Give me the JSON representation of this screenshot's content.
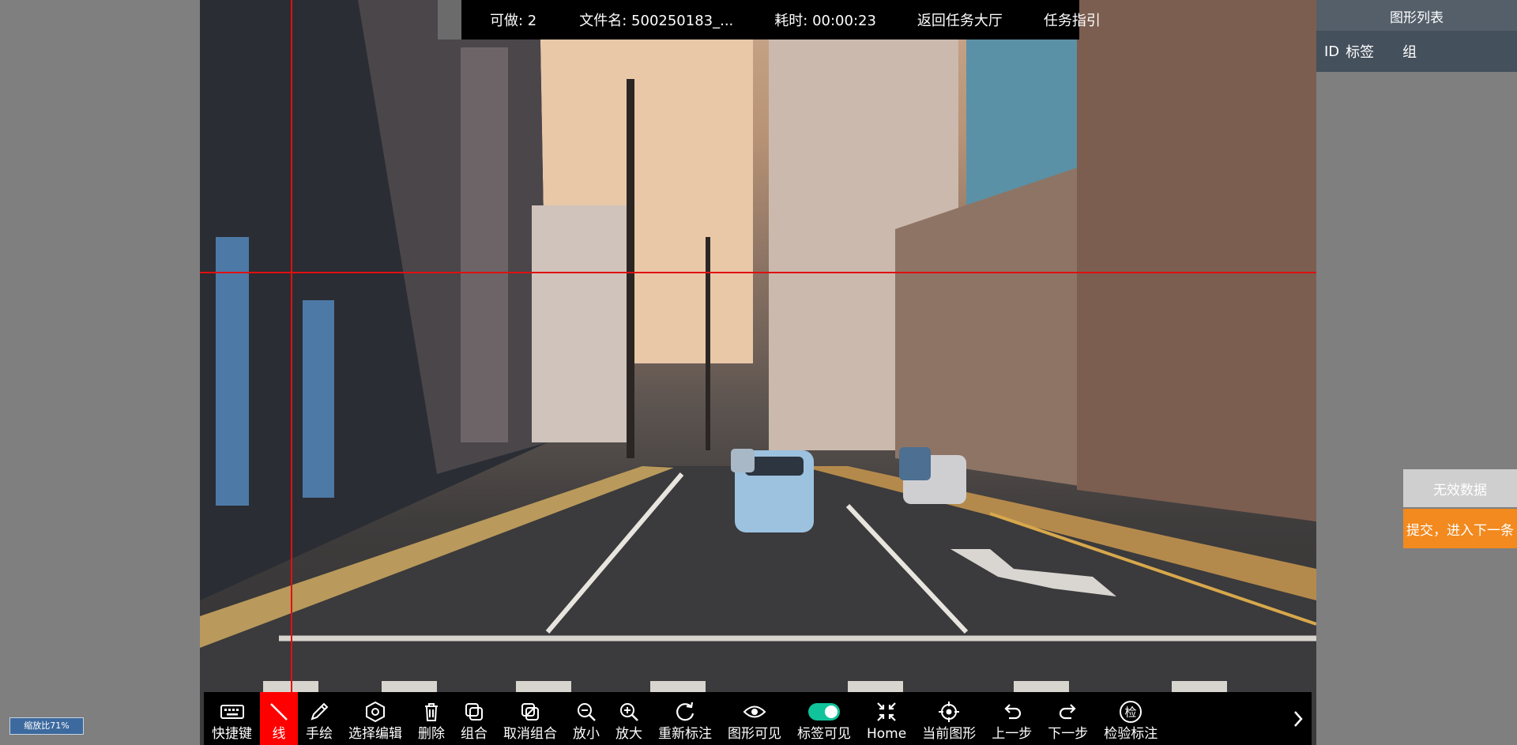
{
  "topbar": {
    "remaining": "可做: 2",
    "filename": "文件名: 500250183_...",
    "elapsed": "耗时: 00:00:23",
    "back": "返回任务大厅",
    "guide": "任务指引"
  },
  "shape_panel": {
    "title": "图形列表",
    "columns": [
      "ID",
      "标签",
      "组"
    ]
  },
  "actions": {
    "invalid": "无效数据",
    "submit": "提交，进入下一条"
  },
  "toolbar": {
    "items": [
      {
        "label": "快捷键",
        "icon": "keyboard-icon"
      },
      {
        "label": "线",
        "icon": "line-icon",
        "active": true
      },
      {
        "label": "手绘",
        "icon": "pencil-icon"
      },
      {
        "label": "选择编辑",
        "icon": "hexagon-select-icon"
      },
      {
        "label": "删除",
        "icon": "trash-icon"
      },
      {
        "label": "组合",
        "icon": "group-icon"
      },
      {
        "label": "取消组合",
        "icon": "ungroup-icon"
      },
      {
        "label": "放小",
        "icon": "zoom-out-icon"
      },
      {
        "label": "放大",
        "icon": "zoom-in-icon"
      },
      {
        "label": "重新标注",
        "icon": "redo-circle-icon"
      },
      {
        "label": "图形可见",
        "icon": "eye-icon"
      },
      {
        "label": "标签可见",
        "icon": "toggle-icon",
        "on": true
      },
      {
        "label": "Home",
        "icon": "home-compress-icon"
      },
      {
        "label": "当前图形",
        "icon": "crosshair-icon"
      },
      {
        "label": "上一步",
        "icon": "undo-icon"
      },
      {
        "label": "下一步",
        "icon": "redo-icon"
      },
      {
        "label": "检验标注",
        "icon": "check-badge-icon",
        "glyph": "检"
      }
    ],
    "more_icon": "chevron-right-icon"
  },
  "zoom": {
    "label": "缩放比71%"
  },
  "colors": {
    "crosshair": "#e01010",
    "active_tool": "#ff0000",
    "submit": "#f28a1f",
    "toggle_on": "#11c39a",
    "panel": "#44505c"
  }
}
